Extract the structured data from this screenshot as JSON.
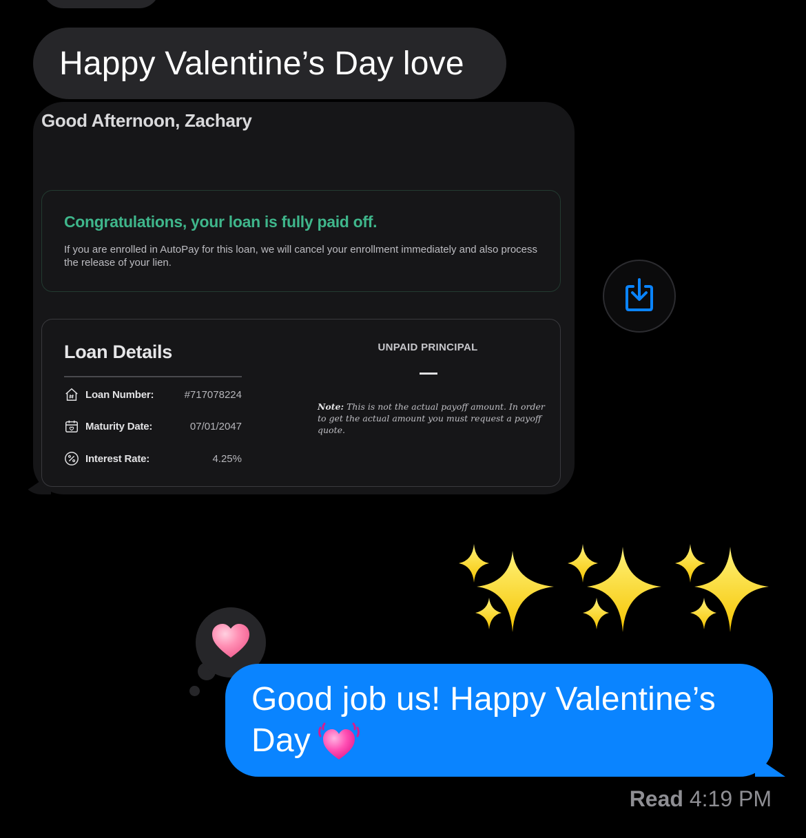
{
  "messages": {
    "incoming_text": "Happy Valentine’s Day love",
    "outgoing_line1": "Good job us! Happy Valentine’s",
    "outgoing_line2": "Day",
    "outgoing_emoji_icon": "growing-heart-icon",
    "tapback_icon": "heart-icon",
    "sparkles_icon": "sparkles-emoji-icon",
    "read_label": "Read",
    "read_time": "4:19 PM"
  },
  "attachment": {
    "greeting": "Good Afternoon, Zachary",
    "congrats_title": "Congratulations, your loan is fully paid off.",
    "congrats_body": "If you are enrolled in AutoPay for this loan, we will cancel your enrollment immediately and also process the release of your lien.",
    "loan_details_title": "Loan Details",
    "rows": [
      {
        "icon": "house-hash-icon",
        "label": "Loan Number:",
        "value": "#717078224"
      },
      {
        "icon": "calendar-heart-icon",
        "label": "Maturity Date:",
        "value": "07/01/2047"
      },
      {
        "icon": "percent-circle-icon",
        "label": "Interest Rate:",
        "value": "4.25%"
      }
    ],
    "unpaid_principal_label": "UNPAID PRINCIPAL",
    "unpaid_principal_value": "—",
    "note_label": "Note:",
    "note_text": "This is not the actual payoff amount. In order to get the actual amount you must request a payoff quote."
  },
  "colors": {
    "background": "#000000",
    "incoming_bubble": "#262629",
    "outgoing_bubble": "#0a84ff",
    "success_green": "#3fb68b",
    "share_icon_blue": "#0a84ff"
  },
  "share_button_icon": "share-download-icon"
}
